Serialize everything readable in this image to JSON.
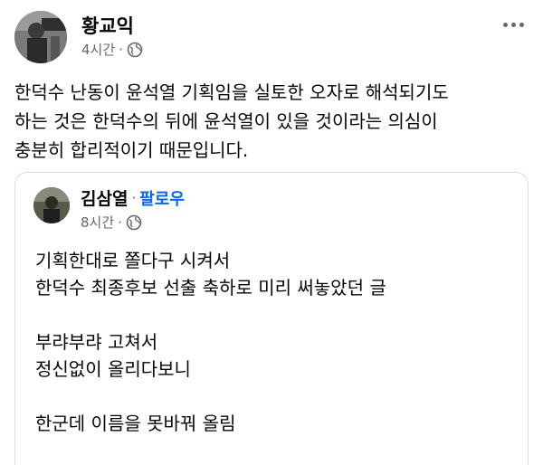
{
  "post": {
    "author": "황교익",
    "time": "4시간",
    "dot": "·",
    "privacy_icon": "globe-icon",
    "text_lines": [
      "한덕수 난동이 윤석열 기획임을 실토한 오자로 해석되기도",
      "하는 것은 한덕수의 뒤에 윤석열이 있을 것이라는 의심이",
      "충분히 합리적이기 때문입니다."
    ]
  },
  "shared": {
    "author": "김삼열",
    "dot": "·",
    "follow_label": "팔로우",
    "time": "8시간",
    "privacy_icon": "globe-icon",
    "lines": {
      "l1": "기획한대로 쫄다구 시켜서",
      "l2": "한덕수 최종후보 선출 축하로 미리 써놓았던 글",
      "l3": "부랴부랴 고쳐서",
      "l4": "정신없이 올리다보니",
      "l5": "한군데 이름을 못바꿔 올림"
    }
  },
  "colors": {
    "meta_gray": "#65676b",
    "link_blue": "#0866ff",
    "border": "#dadde1"
  }
}
